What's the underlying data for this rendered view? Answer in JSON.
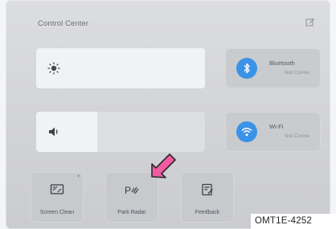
{
  "panel": {
    "title": "Control Center",
    "edit_icon": "edit-icon"
  },
  "brightness": {
    "icon": "sun-icon",
    "level": 1.0
  },
  "volume": {
    "icon": "speaker-icon",
    "level": 0.36
  },
  "tiles": [
    {
      "label": "Bluetooth",
      "status": "Not Conne",
      "icon": "bluetooth-icon",
      "color": "#3b93e8"
    },
    {
      "label": "Wi-Fi",
      "status": "Not Conne",
      "icon": "wifi-icon",
      "color": "#3b93e8"
    }
  ],
  "buttons": [
    {
      "label": "Screen Clean",
      "icon": "screen-clean-icon"
    },
    {
      "label": "Park Radar",
      "icon": "park-radar-icon"
    },
    {
      "label": "Feedback",
      "icon": "feedback-icon"
    }
  ],
  "pointer": {
    "icon": "pointer-arrow-icon",
    "color": "#f25aa3"
  },
  "figure_label": "OMT1E-4252"
}
